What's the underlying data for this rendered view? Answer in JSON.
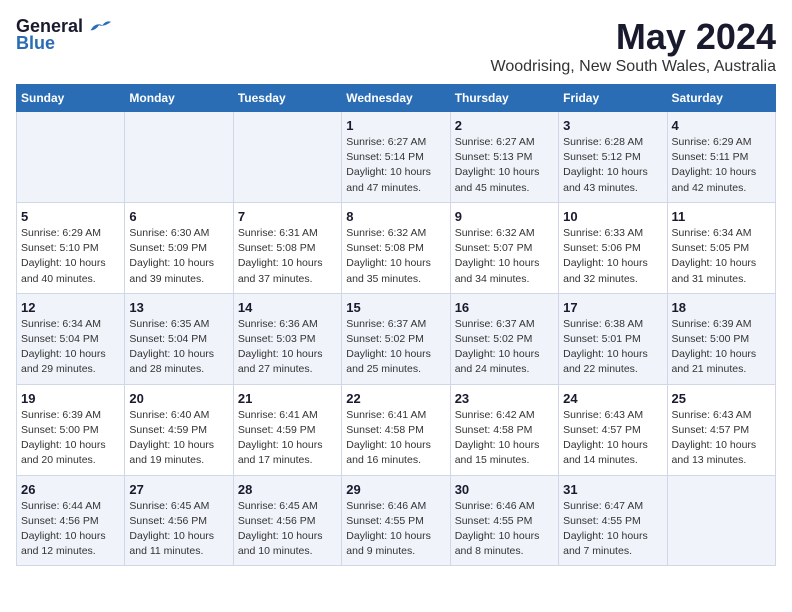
{
  "logo": {
    "general": "General",
    "blue": "Blue"
  },
  "header": {
    "title": "May 2024",
    "subtitle": "Woodrising, New South Wales, Australia"
  },
  "days_of_week": [
    "Sunday",
    "Monday",
    "Tuesday",
    "Wednesday",
    "Thursday",
    "Friday",
    "Saturday"
  ],
  "weeks": [
    [
      {
        "day": "",
        "detail": ""
      },
      {
        "day": "",
        "detail": ""
      },
      {
        "day": "",
        "detail": ""
      },
      {
        "day": "1",
        "detail": "Sunrise: 6:27 AM\nSunset: 5:14 PM\nDaylight: 10 hours\nand 47 minutes."
      },
      {
        "day": "2",
        "detail": "Sunrise: 6:27 AM\nSunset: 5:13 PM\nDaylight: 10 hours\nand 45 minutes."
      },
      {
        "day": "3",
        "detail": "Sunrise: 6:28 AM\nSunset: 5:12 PM\nDaylight: 10 hours\nand 43 minutes."
      },
      {
        "day": "4",
        "detail": "Sunrise: 6:29 AM\nSunset: 5:11 PM\nDaylight: 10 hours\nand 42 minutes."
      }
    ],
    [
      {
        "day": "5",
        "detail": "Sunrise: 6:29 AM\nSunset: 5:10 PM\nDaylight: 10 hours\nand 40 minutes."
      },
      {
        "day": "6",
        "detail": "Sunrise: 6:30 AM\nSunset: 5:09 PM\nDaylight: 10 hours\nand 39 minutes."
      },
      {
        "day": "7",
        "detail": "Sunrise: 6:31 AM\nSunset: 5:08 PM\nDaylight: 10 hours\nand 37 minutes."
      },
      {
        "day": "8",
        "detail": "Sunrise: 6:32 AM\nSunset: 5:08 PM\nDaylight: 10 hours\nand 35 minutes."
      },
      {
        "day": "9",
        "detail": "Sunrise: 6:32 AM\nSunset: 5:07 PM\nDaylight: 10 hours\nand 34 minutes."
      },
      {
        "day": "10",
        "detail": "Sunrise: 6:33 AM\nSunset: 5:06 PM\nDaylight: 10 hours\nand 32 minutes."
      },
      {
        "day": "11",
        "detail": "Sunrise: 6:34 AM\nSunset: 5:05 PM\nDaylight: 10 hours\nand 31 minutes."
      }
    ],
    [
      {
        "day": "12",
        "detail": "Sunrise: 6:34 AM\nSunset: 5:04 PM\nDaylight: 10 hours\nand 29 minutes."
      },
      {
        "day": "13",
        "detail": "Sunrise: 6:35 AM\nSunset: 5:04 PM\nDaylight: 10 hours\nand 28 minutes."
      },
      {
        "day": "14",
        "detail": "Sunrise: 6:36 AM\nSunset: 5:03 PM\nDaylight: 10 hours\nand 27 minutes."
      },
      {
        "day": "15",
        "detail": "Sunrise: 6:37 AM\nSunset: 5:02 PM\nDaylight: 10 hours\nand 25 minutes."
      },
      {
        "day": "16",
        "detail": "Sunrise: 6:37 AM\nSunset: 5:02 PM\nDaylight: 10 hours\nand 24 minutes."
      },
      {
        "day": "17",
        "detail": "Sunrise: 6:38 AM\nSunset: 5:01 PM\nDaylight: 10 hours\nand 22 minutes."
      },
      {
        "day": "18",
        "detail": "Sunrise: 6:39 AM\nSunset: 5:00 PM\nDaylight: 10 hours\nand 21 minutes."
      }
    ],
    [
      {
        "day": "19",
        "detail": "Sunrise: 6:39 AM\nSunset: 5:00 PM\nDaylight: 10 hours\nand 20 minutes."
      },
      {
        "day": "20",
        "detail": "Sunrise: 6:40 AM\nSunset: 4:59 PM\nDaylight: 10 hours\nand 19 minutes."
      },
      {
        "day": "21",
        "detail": "Sunrise: 6:41 AM\nSunset: 4:59 PM\nDaylight: 10 hours\nand 17 minutes."
      },
      {
        "day": "22",
        "detail": "Sunrise: 6:41 AM\nSunset: 4:58 PM\nDaylight: 10 hours\nand 16 minutes."
      },
      {
        "day": "23",
        "detail": "Sunrise: 6:42 AM\nSunset: 4:58 PM\nDaylight: 10 hours\nand 15 minutes."
      },
      {
        "day": "24",
        "detail": "Sunrise: 6:43 AM\nSunset: 4:57 PM\nDaylight: 10 hours\nand 14 minutes."
      },
      {
        "day": "25",
        "detail": "Sunrise: 6:43 AM\nSunset: 4:57 PM\nDaylight: 10 hours\nand 13 minutes."
      }
    ],
    [
      {
        "day": "26",
        "detail": "Sunrise: 6:44 AM\nSunset: 4:56 PM\nDaylight: 10 hours\nand 12 minutes."
      },
      {
        "day": "27",
        "detail": "Sunrise: 6:45 AM\nSunset: 4:56 PM\nDaylight: 10 hours\nand 11 minutes."
      },
      {
        "day": "28",
        "detail": "Sunrise: 6:45 AM\nSunset: 4:56 PM\nDaylight: 10 hours\nand 10 minutes."
      },
      {
        "day": "29",
        "detail": "Sunrise: 6:46 AM\nSunset: 4:55 PM\nDaylight: 10 hours\nand 9 minutes."
      },
      {
        "day": "30",
        "detail": "Sunrise: 6:46 AM\nSunset: 4:55 PM\nDaylight: 10 hours\nand 8 minutes."
      },
      {
        "day": "31",
        "detail": "Sunrise: 6:47 AM\nSunset: 4:55 PM\nDaylight: 10 hours\nand 7 minutes."
      },
      {
        "day": "",
        "detail": ""
      }
    ]
  ]
}
